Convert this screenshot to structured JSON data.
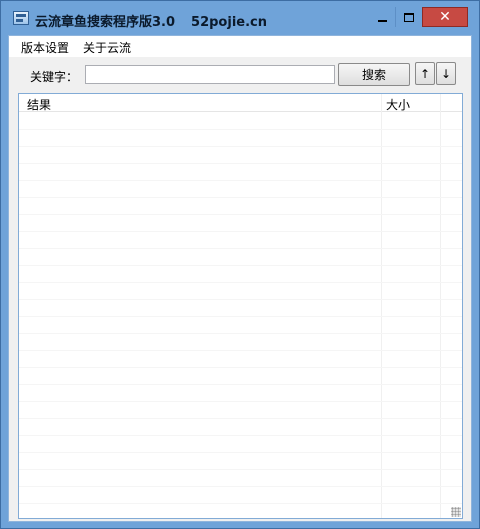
{
  "window": {
    "title": "云流章鱼搜索程序版3.0",
    "title_suffix": "52pojie.cn",
    "close_glyph": "✕",
    "accent_color": "#6fa3d9",
    "close_color": "#c74a43"
  },
  "menubar": {
    "items": [
      {
        "label": "版本设置"
      },
      {
        "label": "关于云流"
      }
    ]
  },
  "search": {
    "label": "关键字：",
    "value": "",
    "placeholder": "",
    "button_label": "搜索",
    "up_label": "↑",
    "down_label": "↓"
  },
  "results": {
    "columns": [
      "结果",
      "大小"
    ],
    "rows": []
  },
  "icons": {
    "app": "app-window-icon",
    "minimize": "minimize-icon",
    "maximize": "maximize-icon",
    "close": "close-icon"
  }
}
